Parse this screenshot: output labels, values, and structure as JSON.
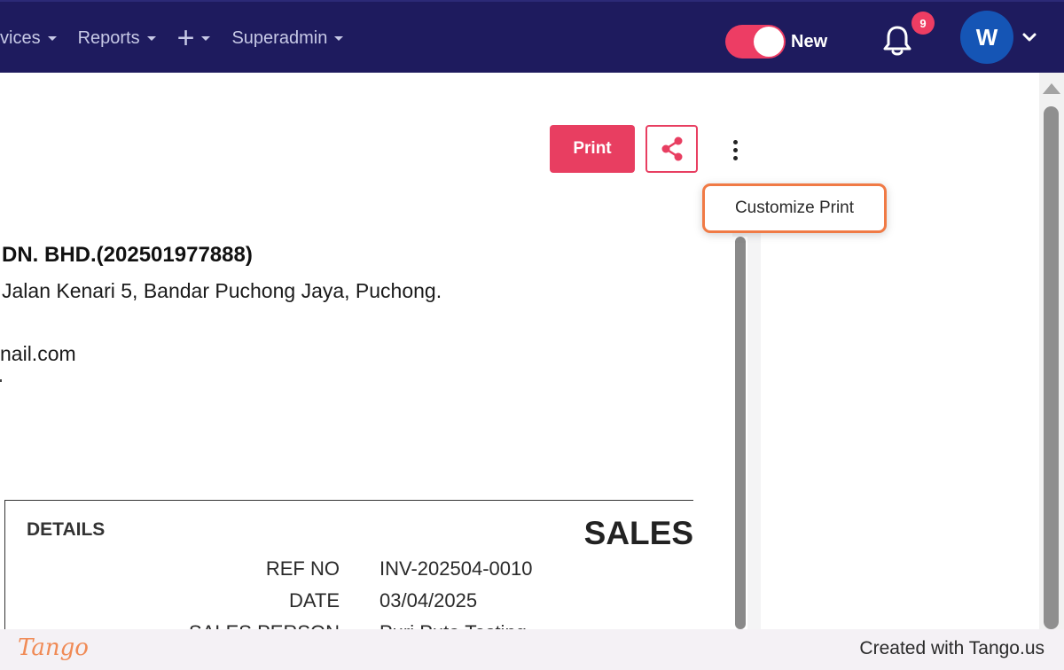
{
  "nav": {
    "items": [
      {
        "label": "vices"
      },
      {
        "label": "Reports"
      },
      {
        "label": "+"
      },
      {
        "label": "Superadmin"
      }
    ],
    "toggle_label": "New",
    "toggle_on": true,
    "notification_count": "9",
    "avatar_initial": "W"
  },
  "toolbar": {
    "print_label": "Print",
    "share_icon": "share-icon",
    "more_icon": "more-vertical-icon"
  },
  "menu": {
    "customize_print_label": "Customize Print"
  },
  "document": {
    "company_name": "DN. BHD.(202501977888)",
    "address": "Jalan Kenari 5, Bandar Puchong Jaya, Puchong.",
    "email": "nail.com",
    "details_title": "DETAILS",
    "sales_title": "SALES",
    "rows": [
      {
        "label": "REF NO",
        "value": "INV-202504-0010"
      },
      {
        "label": "DATE",
        "value": "03/04/2025"
      },
      {
        "label": "SALES PERSON",
        "value": "Puri Puta Testing"
      }
    ]
  },
  "footer": {
    "logo_text": "Tango",
    "credit": "Created with Tango.us"
  },
  "colors": {
    "nav_bg": "#1e1b5e",
    "accent": "#e83e61",
    "highlight": "#f07a45",
    "avatar_bg": "#1555b5"
  }
}
